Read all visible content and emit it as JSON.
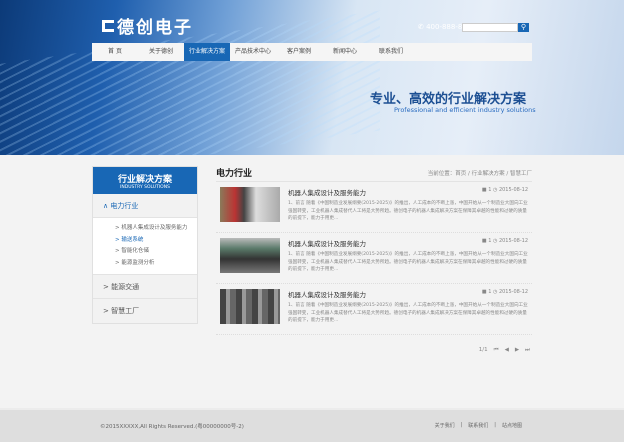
{
  "header": {
    "logo": "德创电子",
    "phone": "400-888-888",
    "search_placeholder": "",
    "search_icon": "search-icon"
  },
  "nav": [
    "首 页",
    "关于德创",
    "行业解决方案",
    "产品技术中心",
    "客户案例",
    "新闻中心",
    "联系我们"
  ],
  "banner": {
    "slogan": "专业、高效的行业解决方案",
    "slogan_en": "Professional and efficient industry solutions"
  },
  "sidebar": {
    "title": "行业解决方案",
    "subtitle": "INDUSTRY SOLUTIONS",
    "categories": [
      {
        "label": "电力行业",
        "subs": [
          "机器人集成设计及服务能力",
          "输送系统",
          "智能化仓储",
          "能源监测分析"
        ]
      },
      {
        "label": "能源交通"
      },
      {
        "label": "智慧工厂"
      }
    ]
  },
  "main": {
    "title": "电力行业",
    "breadcrumb": "当前位置：首页 / 行业解决方案 / 智慧工厂",
    "items": [
      {
        "title": "机器人集成设计及服务能力",
        "views": "1",
        "date": "2015-08-12",
        "desc": "1、前言 随着《中国制造业发展纲要(2015-2025)》的推出，人工成本的不断上涨，中国开始从一个制造业大国向工业强国转变，工业机器人集成替代人工将是大势所趋。德创电子的机器人集成解决方案在保障其卓越的性能和过硬的质量的前提下，能力于用更..."
      },
      {
        "title": "机器人集成设计及服务能力",
        "views": "1",
        "date": "2015-08-12",
        "desc": "1、前言 随着《中国制造业发展纲要(2015-2025)》的推出，人工成本的不断上涨，中国开始从一个制造业大国向工业强国转变，工业机器人集成替代人工将是大势所趋。德创电子的机器人集成解决方案在保障其卓越的性能和过硬的质量的前提下，能力于用更..."
      },
      {
        "title": "机器人集成设计及服务能力",
        "views": "1",
        "date": "2015-08-12",
        "desc": "1、前言 随着《中国制造业发展纲要(2015-2025)》的推出，人工成本的不断上涨，中国开始从一个制造业大国向工业强国转变，工业机器人集成替代人工将是大势所趋。德创电子的机器人集成解决方案在保障其卓越的性能和过硬的质量的前提下，能力于用更..."
      }
    ],
    "pager": {
      "text": "1/1",
      "first": "⏮",
      "prev": "◀",
      "next": "▶",
      "last": "⏭"
    }
  },
  "footer": {
    "copyright": "©2015XXXXX,All Rights Reserved.(粤00000000号-2)",
    "links": [
      "关于我们",
      "|",
      "联系我们",
      "|",
      "站点地图"
    ]
  }
}
